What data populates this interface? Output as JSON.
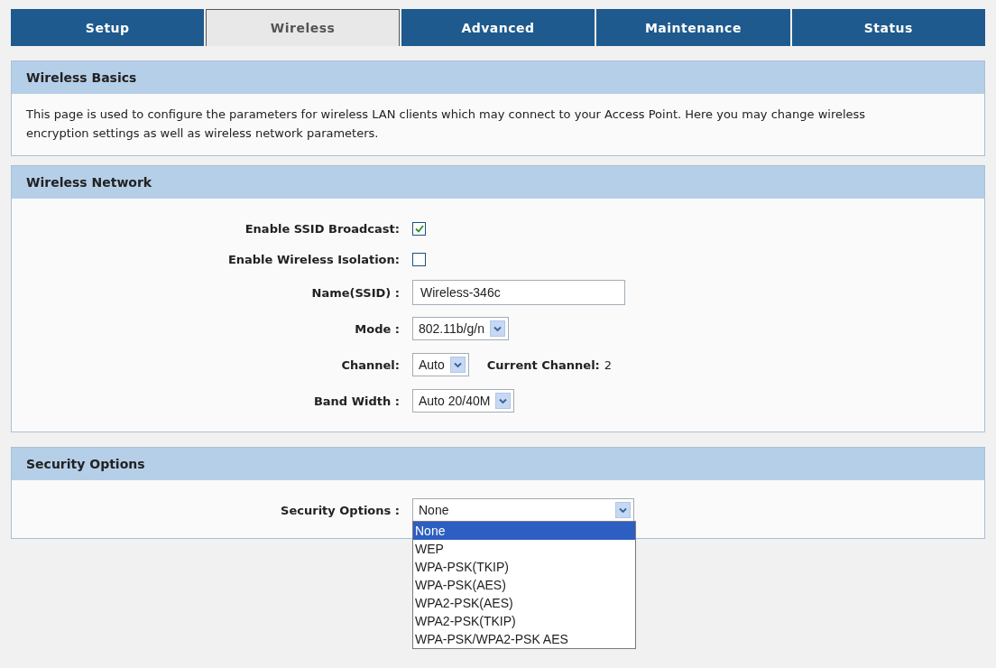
{
  "tabs": [
    {
      "label": "Setup",
      "selected": false
    },
    {
      "label": "Wireless",
      "selected": true
    },
    {
      "label": "Advanced",
      "selected": false
    },
    {
      "label": "Maintenance",
      "selected": false
    },
    {
      "label": "Status",
      "selected": false
    }
  ],
  "basics": {
    "title": "Wireless Basics",
    "text": "This page is used to configure the parameters for wireless LAN clients which may connect to your Access Point. Here you may change wireless encryption settings as well as wireless network parameters."
  },
  "network": {
    "title": "Wireless Network",
    "fields": [
      {
        "kind": "checkbox",
        "label": "Enable SSID Broadcast:",
        "checked": true
      },
      {
        "kind": "checkbox",
        "label": "Enable Wireless Isolation:",
        "checked": false
      },
      {
        "kind": "text",
        "label": "Name(SSID) :",
        "value": "Wireless-346c"
      },
      {
        "kind": "select",
        "label": "Mode :",
        "value": "802.11b/g/n"
      },
      {
        "kind": "select",
        "label": "Channel:",
        "value": "Auto",
        "note_label": "Current Channel:",
        "note_value": "2"
      },
      {
        "kind": "select",
        "label": "Band Width :",
        "value": "Auto 20/40M"
      }
    ]
  },
  "security": {
    "title": "Security Options",
    "label": "Security Options :",
    "value": "None",
    "expanded": true,
    "options": [
      {
        "label": "None",
        "selected": true
      },
      {
        "label": "WEP",
        "selected": false
      },
      {
        "label": "WPA-PSK(TKIP)",
        "selected": false
      },
      {
        "label": "WPA-PSK(AES)",
        "selected": false
      },
      {
        "label": "WPA2-PSK(AES)",
        "selected": false
      },
      {
        "label": "WPA2-PSK(TKIP)",
        "selected": false
      },
      {
        "label": "WPA-PSK/WPA2-PSK AES",
        "selected": false
      }
    ]
  }
}
